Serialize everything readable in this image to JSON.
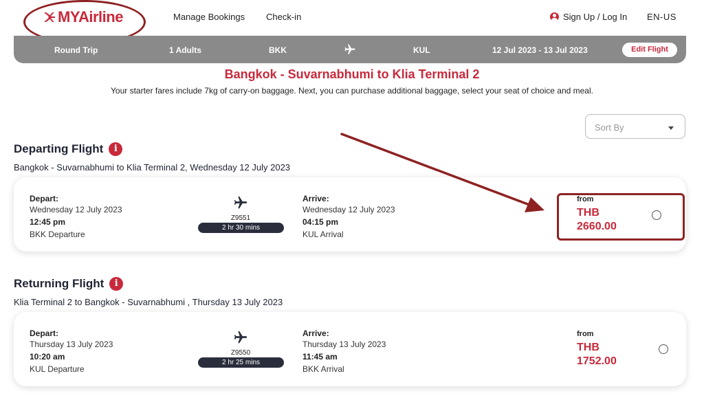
{
  "header": {
    "logo_text": "MYAirline",
    "nav": [
      "Manage Bookings",
      "Check-in"
    ],
    "signin": "Sign Up / Log In",
    "language": "EN-US"
  },
  "search": {
    "trip_type": "Round Trip",
    "passengers": "1 Adults",
    "origin": "BKK",
    "destination": "KUL",
    "dates": "12 Jul 2023 - 13 Jul 2023",
    "edit_label": "Edit Flight"
  },
  "route": {
    "title": "Bangkok - Suvarnabhumi to Klia Terminal 2",
    "subtitle": "Your starter fares include 7kg of carry-on baggage. Next, you can purchase additional baggage, select your seat of choice and meal."
  },
  "sort": {
    "placeholder": "Sort By"
  },
  "departing": {
    "title": "Departing Flight",
    "info": "i",
    "subtitle": "Bangkok - Suvarnabhumi to Klia Terminal 2, Wednesday 12 July 2023",
    "card": {
      "depart_label": "Depart:",
      "depart_date": "Wednesday 12 July 2023",
      "depart_time": "12:45 pm",
      "depart_place": "BKK Departure",
      "flight_no": "Z9551",
      "duration": "2 hr 30 mins",
      "arrive_label": "Arrive:",
      "arrive_date": "Wednesday 12 July 2023",
      "arrive_time": "04:15 pm",
      "arrive_place": "KUL Arrival",
      "from_label": "from",
      "currency": "THB",
      "price": "2660.00"
    }
  },
  "returning": {
    "title": "Returning Flight",
    "info": "i",
    "subtitle": "Klia Terminal 2 to Bangkok - Suvarnabhumi , Thursday 13 July 2023",
    "card": {
      "depart_label": "Depart:",
      "depart_date": "Thursday 13 July 2023",
      "depart_time": "10:20 am",
      "depart_place": "KUL Departure",
      "flight_no": "Z9550",
      "duration": "2 hr 25 mins",
      "arrive_label": "Arrive:",
      "arrive_date": "Thursday 13 July 2023",
      "arrive_time": "11:45 am",
      "arrive_place": "BKK Arrival",
      "from_label": "from",
      "currency": "THB",
      "price": "1752.00"
    }
  },
  "colors": {
    "brand": "#c8293b",
    "annotation": "#8e2222",
    "search_bar": "#8a8a8a",
    "duration_pill": "#2a2e3c"
  },
  "icons": [
    "airplane-logo-icon",
    "user-icon",
    "airplane-icon",
    "info-icon",
    "chevron-down-icon",
    "radio-icon"
  ]
}
